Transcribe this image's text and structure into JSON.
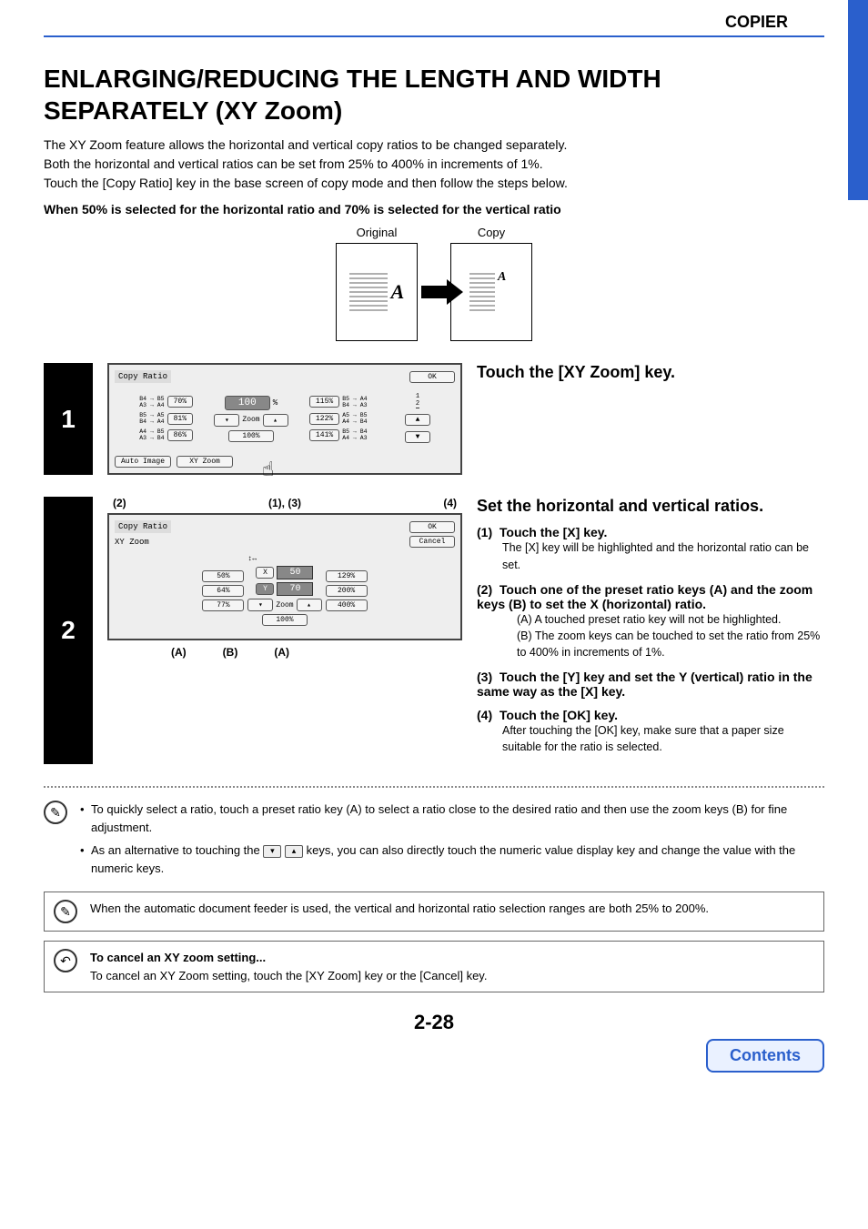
{
  "header": {
    "section": "COPIER"
  },
  "page": {
    "title": "ENLARGING/REDUCING THE LENGTH AND WIDTH SEPARATELY (XY Zoom)",
    "intro1": "The XY Zoom feature allows the horizontal and vertical copy ratios to be changed separately.",
    "intro2": "Both the horizontal and vertical ratios can be set from 25% to 400% in increments of 1%.",
    "intro3": "Touch the [Copy Ratio] key in the base screen of copy mode and then follow the steps below.",
    "subhead": "When 50% is selected for the horizontal ratio and 70% is selected for the vertical ratio"
  },
  "diagram": {
    "original_label": "Original",
    "copy_label": "Copy"
  },
  "step1": {
    "num": "1",
    "title": "Touch the [XY Zoom] key.",
    "panel": {
      "title": "Copy Ratio",
      "ok": "OK",
      "left": [
        {
          "t": "B4 → B5\nA3 → A4",
          "v": "70%"
        },
        {
          "t": "B5 → A5\nB4 → A4",
          "v": "81%"
        },
        {
          "t": "A4 → B5\nA3 → B4",
          "v": "86%"
        }
      ],
      "center_value": "100",
      "percent": "%",
      "zoom": "Zoom",
      "full": "100%",
      "right": [
        {
          "v": "115%",
          "t": "B5 → A4\nB4 → A3"
        },
        {
          "v": "122%",
          "t": "A5 → B5\nA4 → B4"
        },
        {
          "v": "141%",
          "t": "B5 → B4\nA4 → A3"
        }
      ],
      "frac": "1\n2",
      "auto": "Auto Image",
      "xy": "XY Zoom"
    }
  },
  "step2": {
    "num": "2",
    "title": "Set the horizontal and vertical ratios.",
    "callouts_top": [
      "(2)",
      "(1), (3)",
      "(4)"
    ],
    "callouts_bot": [
      "(A)",
      "(B)",
      "(A)"
    ],
    "panel": {
      "title": "Copy Ratio",
      "ok": "OK",
      "sub": "XY Zoom",
      "cancel": "Cancel",
      "x": "X",
      "xv": "50",
      "y": "Y",
      "yv": "70",
      "left": [
        "50%",
        "64%",
        "77%"
      ],
      "right": [
        "129%",
        "200%",
        "400%"
      ],
      "zoom": "Zoom",
      "full": "100%"
    },
    "substeps": [
      {
        "n": "(1)",
        "h": "Touch the [X] key.",
        "b": "The [X] key will be highlighted and the horizontal ratio can be set."
      },
      {
        "n": "(2)",
        "h": "Touch one of the preset ratio keys (A) and the zoom keys (B) to set the X (horizontal) ratio.",
        "list": [
          "(A)  A touched preset ratio key will not be highlighted.",
          "(B)  The zoom keys can be touched to set the ratio from 25% to 400% in increments of 1%."
        ]
      },
      {
        "n": "(3)",
        "h": "Touch the [Y] key and set the Y (vertical) ratio in the same way as the [X] key."
      },
      {
        "n": "(4)",
        "h": "Touch the [OK] key.",
        "b": "After touching the [OK] key, make sure that a paper size suitable for the ratio is selected."
      }
    ]
  },
  "notes": {
    "tip1": "To quickly select a ratio, touch a preset ratio key (A) to select a ratio close to the desired ratio and then use the zoom keys (B) for fine adjustment.",
    "tip2a": "As an alternative to touching the ",
    "tip2b": " keys, you can also directly touch the numeric value display key and change the value with the numeric keys.",
    "box1": "When the automatic document feeder is used, the vertical and horizontal ratio selection ranges are both 25% to 200%.",
    "cancel_h": "To cancel an XY zoom setting...",
    "cancel_b": "To cancel an XY Zoom setting, touch the [XY Zoom] key or the [Cancel] key."
  },
  "footer": {
    "page": "2-28",
    "contents": "Contents"
  }
}
